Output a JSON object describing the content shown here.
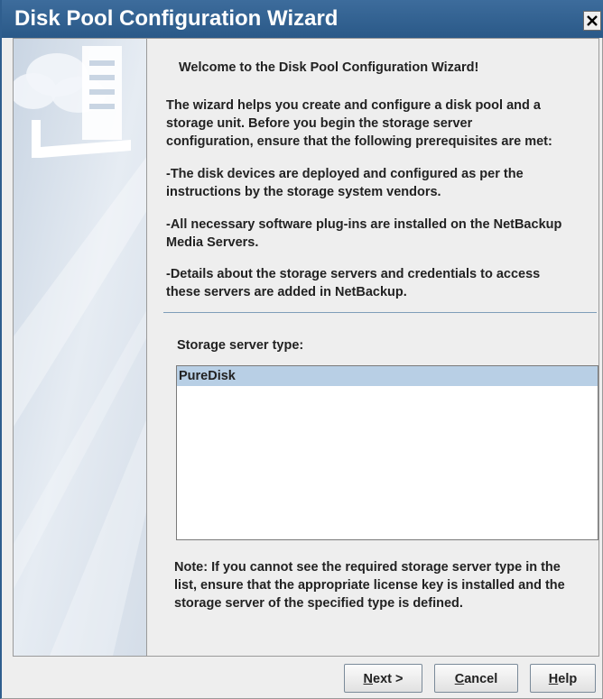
{
  "window": {
    "title": "Disk Pool Configuration Wizard",
    "close_glyph": "✕"
  },
  "content": {
    "welcome": "Welcome to the Disk Pool Configuration Wizard!",
    "intro": "The wizard helps you create and configure a disk pool and a\nstorage unit. Before you begin the storage server\nconfiguration, ensure that the following prerequisites are met:",
    "prerequisites": [
      "-The disk devices are deployed and configured as per the\n instructions by the storage system vendors.",
      "-All necessary software plug-ins are installed on the NetBackup\n Media Servers.",
      "-Details about the storage servers and credentials to access\n these servers are added in NetBackup."
    ],
    "server_type_label": "Storage server type:",
    "server_types": [
      "PureDisk"
    ],
    "selected_server_type": "PureDisk",
    "note": "Note: If you cannot see the required storage server type in the\nlist, ensure that the appropriate license key is installed and the\nstorage server of the specified type is defined."
  },
  "buttons": {
    "next": {
      "mnemonic": "N",
      "rest": "ext >"
    },
    "cancel": {
      "mnemonic": "C",
      "rest": "ancel"
    },
    "help": {
      "mnemonic": "H",
      "rest": "elp"
    }
  },
  "icons": {
    "close": "close-icon",
    "side_art": "storage-server-illustration"
  },
  "colors": {
    "titlebar": "#2f5e8e",
    "selection": "#b8cfe5",
    "side_panel": "#dfe6ef"
  }
}
